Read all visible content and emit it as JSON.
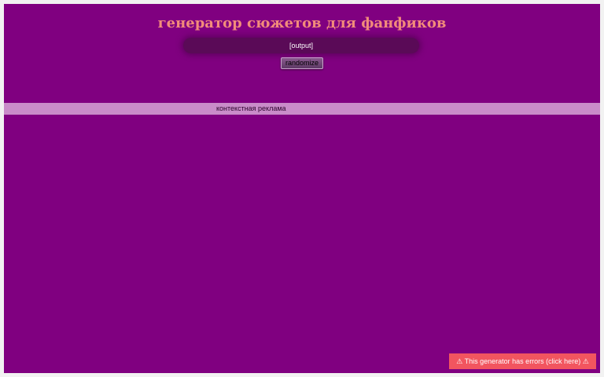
{
  "header": {
    "title": "генератор сюжетов для фанфиков"
  },
  "output": {
    "text": "[output]"
  },
  "controls": {
    "randomize_label": "randomize"
  },
  "ad": {
    "label": "контекстная реклама"
  },
  "error_notice": {
    "label": "⚠ This generator has errors (click here) ⚠"
  },
  "colors": {
    "background": "#800080",
    "title": "#f28c7a",
    "output_box": "#5a0a57",
    "ad_bar": "#c98cc9",
    "error_button": "#f2555f"
  }
}
